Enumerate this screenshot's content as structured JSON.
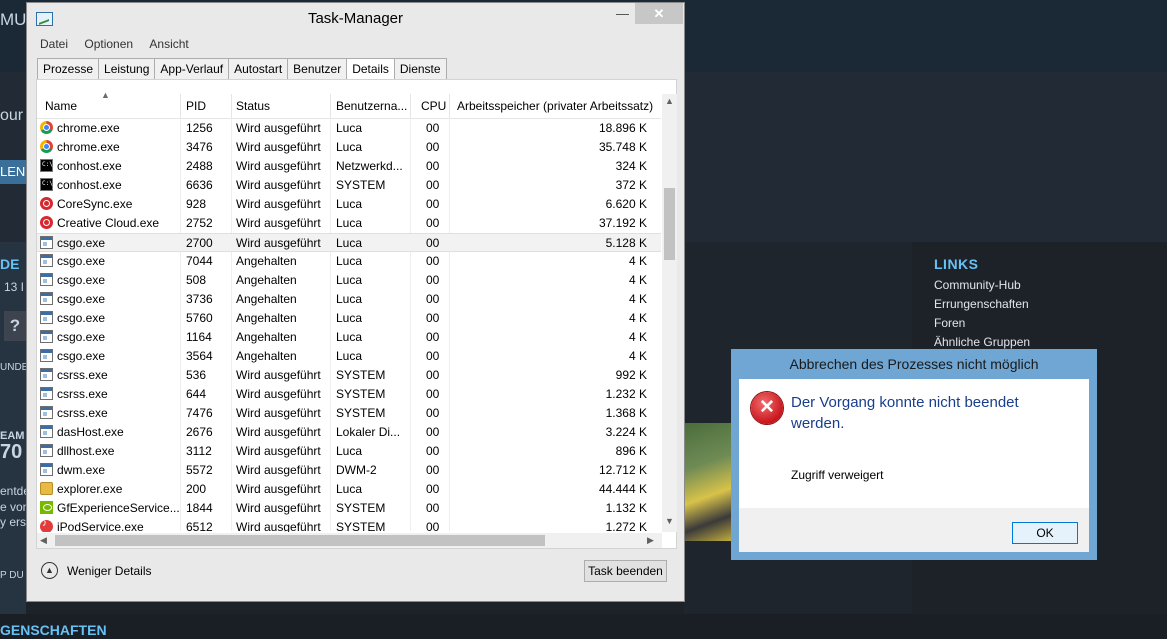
{
  "background": {
    "frag_top_left": "MU",
    "frag_left_mid": "our",
    "frag_left_btn": "LEN",
    "frag_de": "DE",
    "frag_13": "13 I",
    "frag_q": "?",
    "frag_unde": "UNDE",
    "frag_eam": "EAM",
    "frag_70": "70",
    "frag_entde": "entde",
    "frag_evon": "e von",
    "frag_ers": "y ers",
    "frag_pdu": "P DU",
    "frag_bottom": "GENSCHAFTEN",
    "links": {
      "title": "LINKS",
      "items": [
        "Community-Hub",
        "Errungenschaften",
        "Foren",
        "Ähnliche Gruppen"
      ]
    }
  },
  "taskmanager": {
    "title": "Task-Manager",
    "menu": [
      "Datei",
      "Optionen",
      "Ansicht"
    ],
    "tabs": [
      "Prozesse",
      "Leistung",
      "App-Verlauf",
      "Autostart",
      "Benutzer",
      "Details",
      "Dienste"
    ],
    "active_tab": "Details",
    "columns": {
      "name": "Name",
      "pid": "PID",
      "status": "Status",
      "user": "Benutzerna...",
      "cpu": "CPU",
      "mem": "Arbeitsspeicher (privater Arbeitssatz)"
    },
    "rows": [
      {
        "name": "chrome.exe",
        "pid": "1256",
        "status": "Wird ausgeführt",
        "user": "Luca",
        "cpu": "00",
        "mem": "18.896 K",
        "icon": "chrome-icon"
      },
      {
        "name": "chrome.exe",
        "pid": "3476",
        "status": "Wird ausgeführt",
        "user": "Luca",
        "cpu": "00",
        "mem": "35.748 K",
        "icon": "chrome-icon"
      },
      {
        "name": "conhost.exe",
        "pid": "2488",
        "status": "Wird ausgeführt",
        "user": "Netzwerkd...",
        "cpu": "00",
        "mem": "324 K",
        "icon": "console-icon"
      },
      {
        "name": "conhost.exe",
        "pid": "6636",
        "status": "Wird ausgeführt",
        "user": "SYSTEM",
        "cpu": "00",
        "mem": "372 K",
        "icon": "console-icon"
      },
      {
        "name": "CoreSync.exe",
        "pid": "928",
        "status": "Wird ausgeführt",
        "user": "Luca",
        "cpu": "00",
        "mem": "6.620 K",
        "icon": "adobe-icon"
      },
      {
        "name": "Creative Cloud.exe",
        "pid": "2752",
        "status": "Wird ausgeführt",
        "user": "Luca",
        "cpu": "00",
        "mem": "37.192 K",
        "icon": "adobe-icon"
      },
      {
        "name": "csgo.exe",
        "pid": "2700",
        "status": "Wird ausgeführt",
        "user": "Luca",
        "cpu": "00",
        "mem": "5.128 K",
        "icon": "app-icon",
        "selected": true
      },
      {
        "name": "csgo.exe",
        "pid": "7044",
        "status": "Angehalten",
        "user": "Luca",
        "cpu": "00",
        "mem": "4 K",
        "icon": "app-icon"
      },
      {
        "name": "csgo.exe",
        "pid": "508",
        "status": "Angehalten",
        "user": "Luca",
        "cpu": "00",
        "mem": "4 K",
        "icon": "app-icon"
      },
      {
        "name": "csgo.exe",
        "pid": "3736",
        "status": "Angehalten",
        "user": "Luca",
        "cpu": "00",
        "mem": "4 K",
        "icon": "app-icon"
      },
      {
        "name": "csgo.exe",
        "pid": "5760",
        "status": "Angehalten",
        "user": "Luca",
        "cpu": "00",
        "mem": "4 K",
        "icon": "app-icon"
      },
      {
        "name": "csgo.exe",
        "pid": "1164",
        "status": "Angehalten",
        "user": "Luca",
        "cpu": "00",
        "mem": "4 K",
        "icon": "app-icon"
      },
      {
        "name": "csgo.exe",
        "pid": "3564",
        "status": "Angehalten",
        "user": "Luca",
        "cpu": "00",
        "mem": "4 K",
        "icon": "app-icon"
      },
      {
        "name": "csrss.exe",
        "pid": "536",
        "status": "Wird ausgeführt",
        "user": "SYSTEM",
        "cpu": "00",
        "mem": "992 K",
        "icon": "app-icon"
      },
      {
        "name": "csrss.exe",
        "pid": "644",
        "status": "Wird ausgeführt",
        "user": "SYSTEM",
        "cpu": "00",
        "mem": "1.232 K",
        "icon": "app-icon"
      },
      {
        "name": "csrss.exe",
        "pid": "7476",
        "status": "Wird ausgeführt",
        "user": "SYSTEM",
        "cpu": "00",
        "mem": "1.368 K",
        "icon": "app-icon"
      },
      {
        "name": "dasHost.exe",
        "pid": "2676",
        "status": "Wird ausgeführt",
        "user": "Lokaler Di...",
        "cpu": "00",
        "mem": "3.224 K",
        "icon": "app-icon"
      },
      {
        "name": "dllhost.exe",
        "pid": "3112",
        "status": "Wird ausgeführt",
        "user": "Luca",
        "cpu": "00",
        "mem": "896 K",
        "icon": "app-icon"
      },
      {
        "name": "dwm.exe",
        "pid": "5572",
        "status": "Wird ausgeführt",
        "user": "DWM-2",
        "cpu": "00",
        "mem": "12.712 K",
        "icon": "app-icon"
      },
      {
        "name": "explorer.exe",
        "pid": "200",
        "status": "Wird ausgeführt",
        "user": "Luca",
        "cpu": "00",
        "mem": "44.444 K",
        "icon": "explorer-icon"
      },
      {
        "name": "GfExperienceService....",
        "pid": "1844",
        "status": "Wird ausgeführt",
        "user": "SYSTEM",
        "cpu": "00",
        "mem": "1.132 K",
        "icon": "nvidia-icon"
      },
      {
        "name": "iPodService.exe",
        "pid": "6512",
        "status": "Wird ausgeführt",
        "user": "SYSTEM",
        "cpu": "00",
        "mem": "1.272 K",
        "icon": "ipod-icon"
      }
    ],
    "footer": {
      "less_details": "Weniger Details",
      "end_task": "Task beenden"
    }
  },
  "dialog": {
    "title": "Abbrechen des Prozesses nicht möglich",
    "message": "Der Vorgang konnte nicht beendet werden.",
    "detail": "Zugriff verweigert",
    "ok": "OK"
  }
}
